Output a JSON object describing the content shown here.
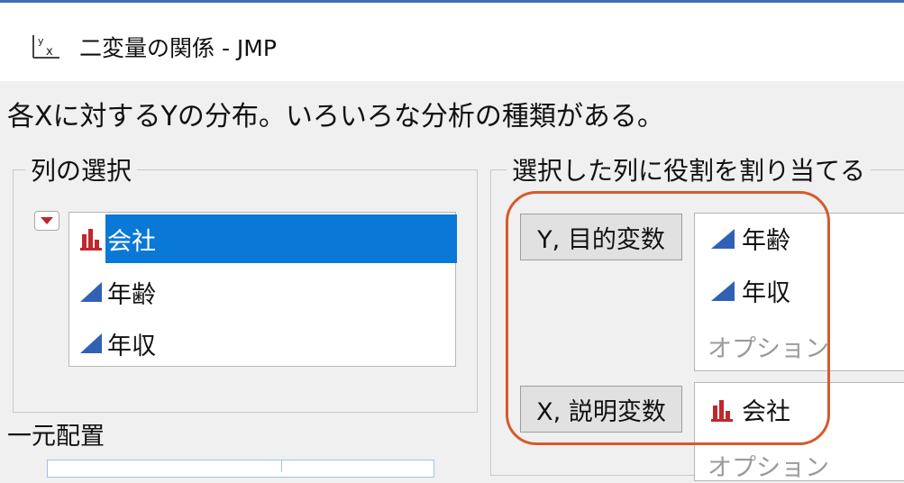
{
  "window": {
    "title": "二変量の関係 - JMP",
    "icon": "bivariate-yx-icon",
    "border_color": "#3c6fb2"
  },
  "description": "各Xに対するYの分布。いろいろな分析の種類がある。",
  "column_select": {
    "label": "列の選択",
    "menu_icon": "red-triangle-icon",
    "items": [
      {
        "label": "会社",
        "icon": "nominal-bar-icon",
        "selected": true
      },
      {
        "label": "年齢",
        "icon": "continuous-ramp-icon",
        "selected": false
      },
      {
        "label": "年収",
        "icon": "continuous-ramp-icon",
        "selected": false
      }
    ]
  },
  "roles": {
    "label": "選択した列に役割を割り当てる",
    "y": {
      "button": "Y, 目的変数",
      "items": [
        "年齢",
        "年収"
      ],
      "option": "オプション"
    },
    "x": {
      "button": "X, 説明変数",
      "items": [
        "会社"
      ],
      "option": "オプション"
    }
  },
  "section_below": "一元配置",
  "colors": {
    "selection": "#0a78d7",
    "highlight": "#d65a2b",
    "nominal": "#c0282d",
    "continuous": "#2f62b5"
  }
}
